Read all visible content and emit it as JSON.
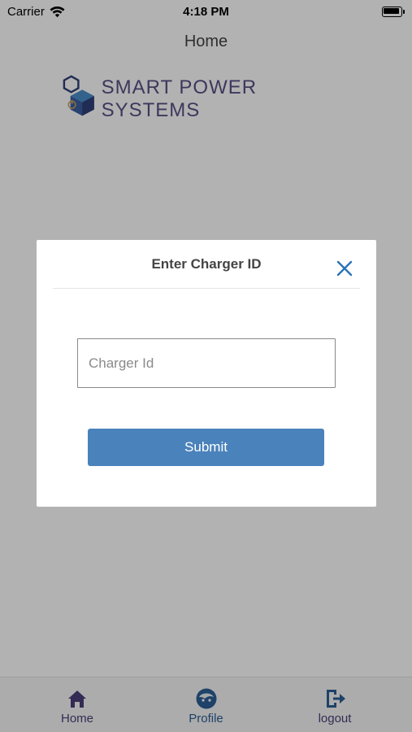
{
  "status_bar": {
    "carrier": "Carrier",
    "time": "4:18 PM",
    "icons": [
      "wifi-icon",
      "battery-icon"
    ]
  },
  "header": {
    "title": "Home"
  },
  "logo": {
    "text": "SMART POWER SYSTEMS",
    "colors": {
      "hex_dark": "#2e3f78",
      "hex_light": "#4a8fc9",
      "accent": "#c9a35a"
    }
  },
  "modal": {
    "title": "Enter Charger ID",
    "close_icon": "close-icon",
    "input": {
      "value": "",
      "placeholder": "Charger Id"
    },
    "submit_label": "Submit"
  },
  "tabbar": {
    "items": [
      {
        "label": "Home",
        "icon": "home-icon",
        "active": false
      },
      {
        "label": "Profile",
        "icon": "profile-icon",
        "active": true
      },
      {
        "label": "logout",
        "icon": "logout-icon",
        "active": false
      }
    ]
  },
  "colors": {
    "primary_button": "#4a82bb",
    "close_icon": "#2b73b6",
    "tab_icon": "#4a3e78",
    "tab_active_label": "#2b5f95",
    "overlay": "rgba(0,0,0,0.3)"
  }
}
